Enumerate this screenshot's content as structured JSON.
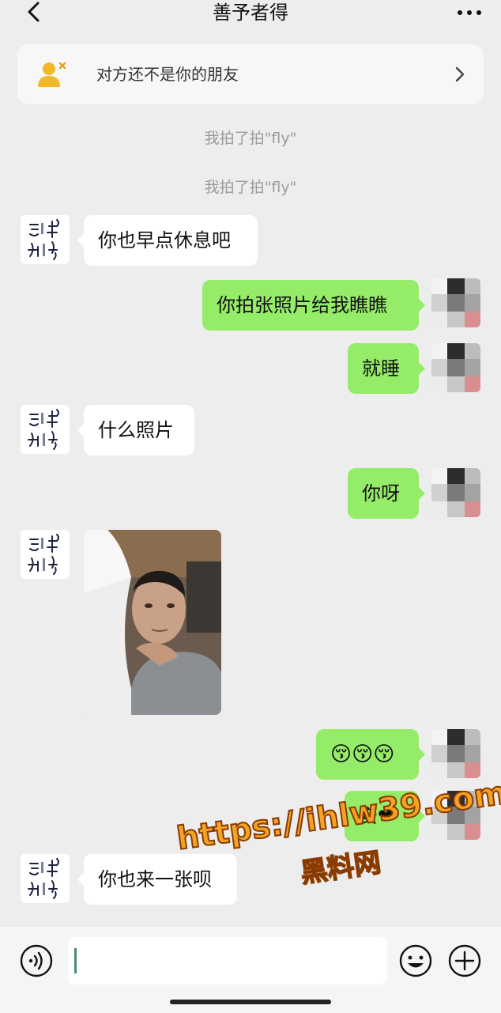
{
  "header": {
    "title": "善予者得"
  },
  "notice": {
    "text": "对方还不是你的朋友"
  },
  "messages": [
    {
      "type": "system",
      "text": "我拍了拍\"fly\""
    },
    {
      "type": "system",
      "text": "我拍了拍\"fly\""
    },
    {
      "type": "in",
      "text": "你也早点休息吧"
    },
    {
      "type": "out",
      "text": "你拍张照片给我瞧瞧"
    },
    {
      "type": "out",
      "text": "就睡"
    },
    {
      "type": "in",
      "text": "什么照片"
    },
    {
      "type": "out",
      "text": "你呀"
    },
    {
      "type": "in-image",
      "text": ""
    },
    {
      "type": "out",
      "text": "😚😚😚"
    },
    {
      "type": "out",
      "text": "安❤"
    },
    {
      "type": "in",
      "text": "你也来一张呗"
    }
  ],
  "watermark": {
    "url": "https://ihlw39.com",
    "name": "黑料网"
  },
  "icons": {
    "back": "chevron-left-icon",
    "more": "more-dots-icon",
    "notice": "user-warning-icon",
    "voice": "voice-icon",
    "emoji": "emoji-icon",
    "plus": "plus-icon"
  }
}
